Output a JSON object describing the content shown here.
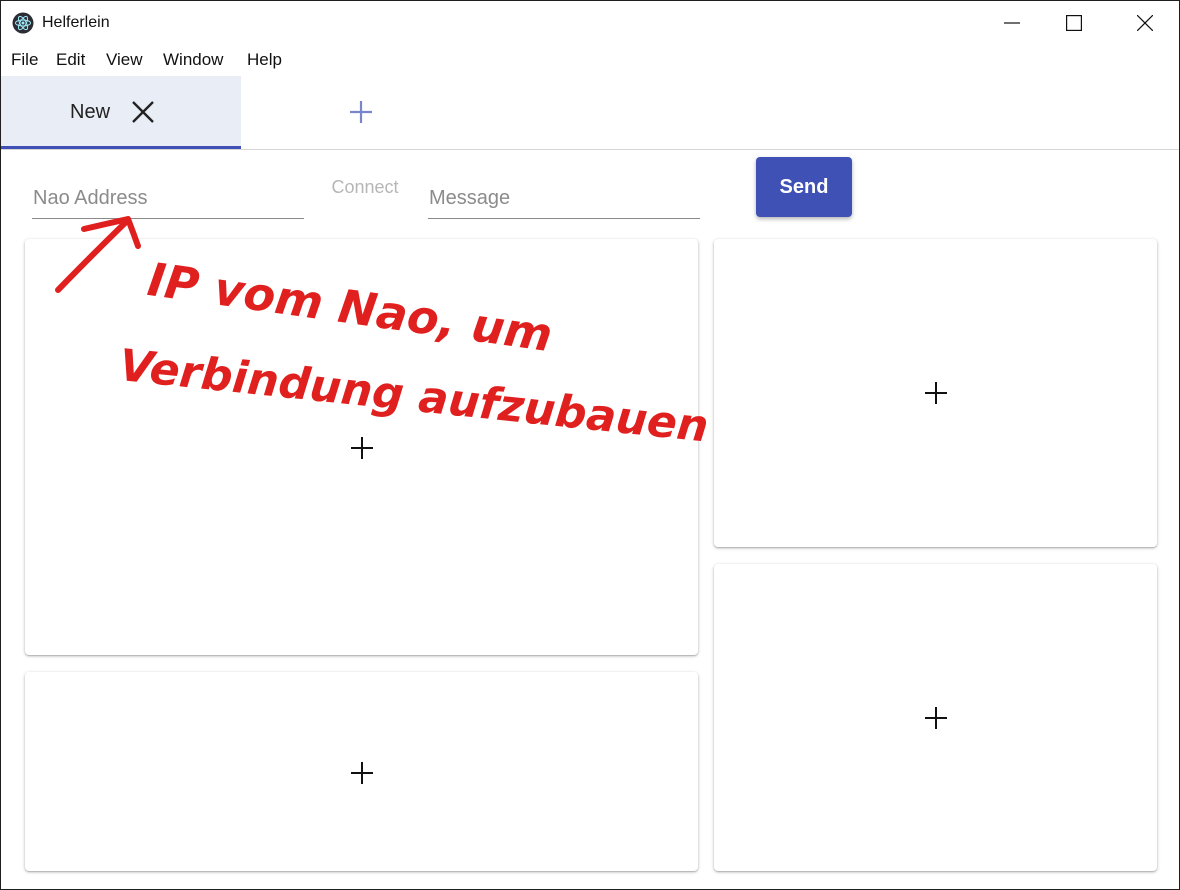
{
  "window": {
    "title": "Helferlein",
    "app_icon": "electron-atom-icon",
    "controls": [
      "minimize-icon",
      "maximize-icon",
      "close-icon"
    ]
  },
  "menu": [
    "File",
    "Edit",
    "View",
    "Window",
    "Help"
  ],
  "tabs": [
    {
      "label": "New",
      "active": true,
      "close_icon": "close-icon"
    }
  ],
  "add_tab_icon": "plus-icon",
  "form": {
    "nao_address": {
      "placeholder": "Nao Address",
      "value": ""
    },
    "connect_label": "Connect",
    "message": {
      "placeholder": "Message",
      "value": ""
    },
    "send_label": "Send"
  },
  "cards": [
    {
      "icon": "plus-icon"
    },
    {
      "icon": "plus-icon"
    },
    {
      "icon": "plus-icon"
    },
    {
      "icon": "plus-icon"
    }
  ],
  "annotation": {
    "line1": "IP vom Nao, um",
    "line2": "Verbindung aufzubauen",
    "color": "#e0201f"
  },
  "colors": {
    "primary": "#3f51b5",
    "tab_active_bg": "#e9edf6"
  }
}
